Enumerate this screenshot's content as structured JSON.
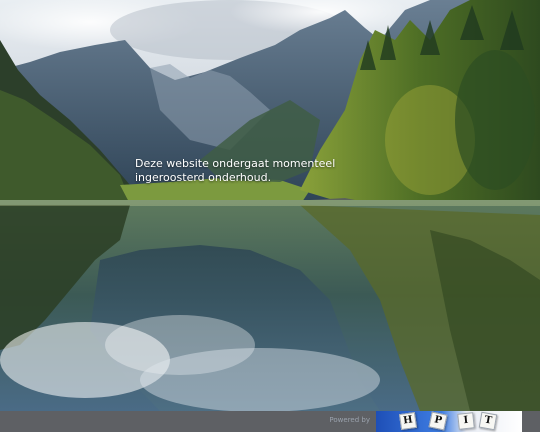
{
  "notice": {
    "message": "Deze website ondergaat momenteel ingeroosterd onderhoud."
  },
  "footer": {
    "powered_by": "Powered by",
    "logo_letters": [
      "H",
      "P",
      "I",
      "T"
    ]
  },
  "colors": {
    "sky": "#cfd6de",
    "mountain": "#3c5770",
    "forest": "#3a5a24",
    "lake": "#4b6a58",
    "footer_bar": "#202228",
    "logo_blue": "#2a62c9"
  }
}
